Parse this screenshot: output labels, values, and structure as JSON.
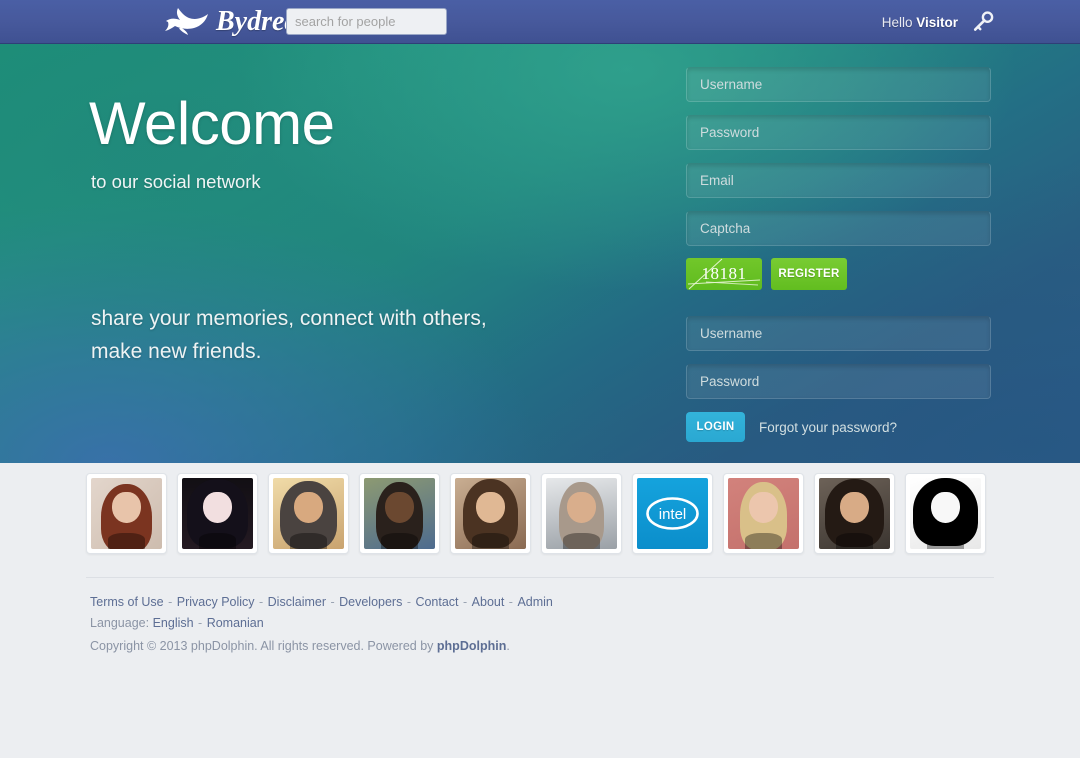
{
  "header": {
    "brand_name": "Bydread",
    "logo_icon": "dolphin-icon",
    "search_placeholder": "search for people",
    "search_value": "",
    "greeting_prefix": "Hello ",
    "greeting_user": "Visitor",
    "key_icon": "key-icon",
    "bg_color": "#47599c"
  },
  "hero": {
    "title": "Welcome",
    "subtitle": "to our social network",
    "tagline_line1": "share your memories, connect with others,",
    "tagline_line2": "make new friends."
  },
  "register": {
    "username_placeholder": "Username",
    "username_value": "",
    "password_placeholder": "Password",
    "password_value": "",
    "email_placeholder": "Email",
    "email_value": "",
    "captcha_placeholder": "Captcha",
    "captcha_value": "",
    "captcha_code": "18181",
    "captcha_bg_color": "#66bf22",
    "submit_label": "REGISTER",
    "submit_color": "#6dc52a"
  },
  "login": {
    "username_placeholder": "Username",
    "username_value": "",
    "password_placeholder": "Password",
    "password_value": "",
    "submit_label": "LOGIN",
    "submit_color": "#2eaed6",
    "forgot_label": "Forgot your password?"
  },
  "members": {
    "avatars": [
      {
        "name": "avatar-1",
        "alt": "woman with red hair against brick wall"
      },
      {
        "name": "avatar-2",
        "alt": "woman with dark hair pale makeup"
      },
      {
        "name": "avatar-3",
        "alt": "older man with grey hair black shirt"
      },
      {
        "name": "avatar-4",
        "alt": "man in blue tracksuit"
      },
      {
        "name": "avatar-5",
        "alt": "woman with long brown hair"
      },
      {
        "name": "avatar-6",
        "alt": "bald man in dark jacket"
      },
      {
        "name": "avatar-7",
        "alt": "intel logo"
      },
      {
        "name": "avatar-8",
        "alt": "blonde woman in black blazer"
      },
      {
        "name": "avatar-9",
        "alt": "man with long hair and glasses"
      },
      {
        "name": "avatar-10",
        "alt": "high contrast black and white portrait"
      }
    ]
  },
  "footer": {
    "links": [
      "Terms of Use",
      "Privacy Policy",
      "Disclaimer",
      "Developers",
      "Contact",
      "About",
      "Admin"
    ],
    "separator": "-",
    "language_label": "Language:",
    "languages": [
      "English",
      "Romanian"
    ],
    "copyright_pre": "Copyright © 2013 phpDolphin. All rights reserved. Powered by ",
    "copyright_link": "phpDolphin",
    "copyright_post": "."
  }
}
